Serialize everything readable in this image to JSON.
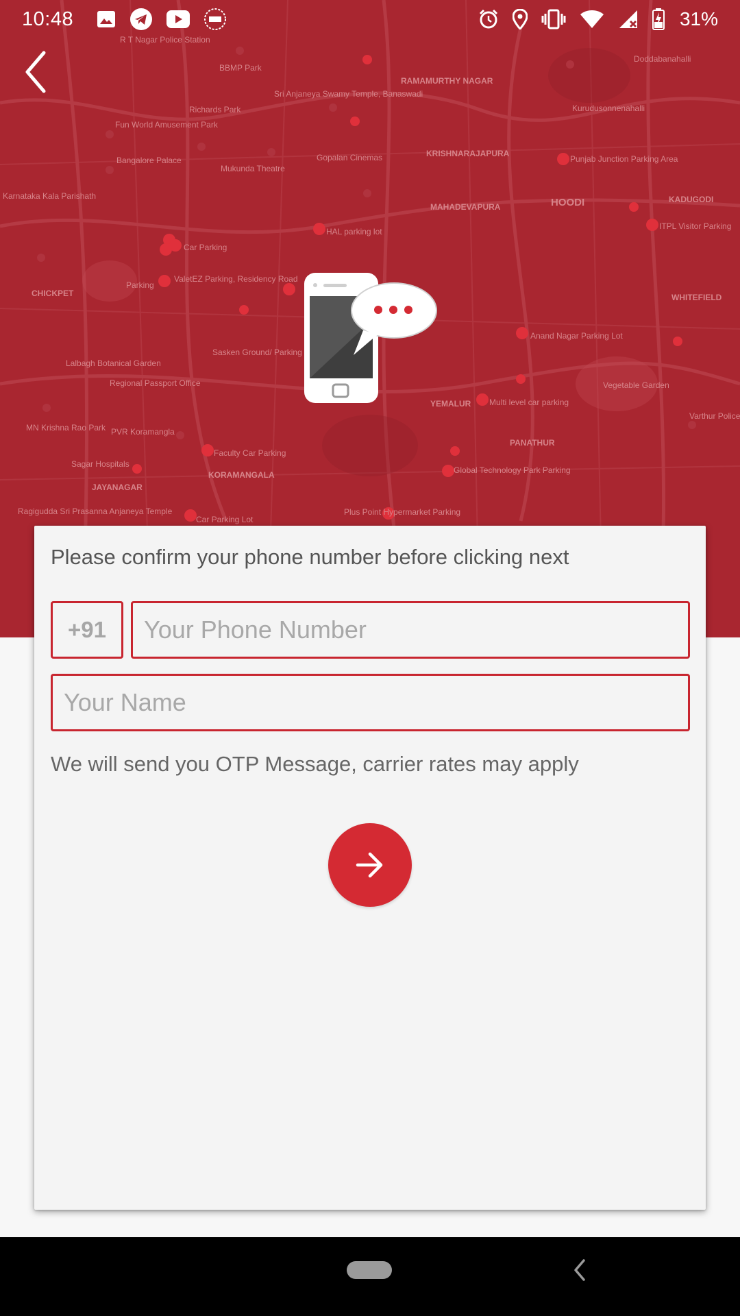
{
  "status_bar": {
    "time": "10:48",
    "battery": "31%",
    "left_icons": [
      "image-icon",
      "telegram-icon",
      "youtube-icon",
      "app-badge-icon"
    ],
    "right_icons": [
      "alarm-icon",
      "location-icon",
      "vibrate-icon",
      "wifi-icon",
      "signal-icon",
      "battery-icon"
    ]
  },
  "map": {
    "labels": [
      "R T Nagar Police Station",
      "BBMP Park",
      "RAMAMURTHY NAGAR",
      "Doddabanahalli",
      "Sri Anjaneya Swamy Temple, Banaswadi",
      "Richards Park",
      "Fun World Amusement Park",
      "Kurudusonnenahalli",
      "Gopalan Cinemas",
      "KRISHNARAJAPURA",
      "Punjab Junction Parking Area",
      "Bangalore Palace",
      "Mukunda Theatre",
      "HOODI",
      "KADUGODI",
      "ITPL Visitor Parking",
      "MAHADEVAPURA",
      "HAL parking lot",
      "Karnataka Kala Parishath",
      "Car Parking",
      "ValetEZ Parking, Residency Road",
      "Parking",
      "CHICKPET",
      "WHITEFIELD",
      "Anand Nagar Parking Lot",
      "Sasken Ground/ Parking Space",
      "Lalbagh Botanical Garden",
      "Regional Passport Office",
      "YEMALUR",
      "Multi level car parking",
      "Vegetable Garden",
      "MN Krishna Rao Park",
      "PVR Koramangla",
      "Faculty Car Parking",
      "PANATHUR",
      "Global Technology Park Parking",
      "Varthur Police",
      "Sagar Hospitals",
      "JAYANAGAR",
      "KORAMANGALA",
      "Ragigudda Sri Prasanna Anjaneya Temple",
      "Car Parking Lot",
      "Plus Point Hypermarket Parking"
    ]
  },
  "form": {
    "instruction": "Please confirm your phone number before clicking next",
    "country_code": "+91",
    "phone_placeholder": "Your Phone Number",
    "name_placeholder": "Your Name",
    "note": "We will send you OTP Message, carrier rates may apply"
  },
  "colors": {
    "header_red": "#a92630",
    "accent_red": "#d42a33",
    "field_border": "#c8252f"
  }
}
